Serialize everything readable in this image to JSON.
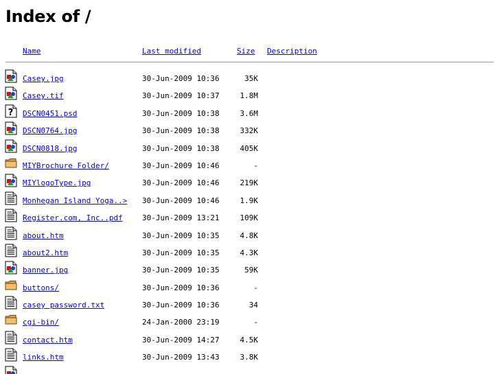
{
  "page": {
    "title": "Index of /"
  },
  "columns": {
    "name": "Name",
    "last_modified": "Last modified",
    "size": "Size",
    "description": "Description"
  },
  "entries": [
    {
      "icon": "image-icon",
      "name": "Casey.jpg",
      "modified": "30-Jun-2009 10:36",
      "size": "35K"
    },
    {
      "icon": "image-icon",
      "name": "Casey.tif",
      "modified": "30-Jun-2009 10:37",
      "size": "1.8M"
    },
    {
      "icon": "unknown-file-icon",
      "name": "DSCN0451.psd",
      "modified": "30-Jun-2009 10:38",
      "size": "3.6M"
    },
    {
      "icon": "image-icon",
      "name": "DSCN0764.jpg",
      "modified": "30-Jun-2009 10:38",
      "size": "332K"
    },
    {
      "icon": "image-icon",
      "name": "DSCN0818.jpg",
      "modified": "30-Jun-2009 10:38",
      "size": "405K"
    },
    {
      "icon": "folder-icon",
      "name": "MIYBrochure Folder/",
      "modified": "30-Jun-2009 10:46",
      "size": "-"
    },
    {
      "icon": "image-icon",
      "name": "MIYlogoType.jpg",
      "modified": "30-Jun-2009 10:46",
      "size": "219K"
    },
    {
      "icon": "text-file-icon",
      "name": "Monhegan Island Yoga..>",
      "modified": "30-Jun-2009 10:46",
      "size": "1.9K"
    },
    {
      "icon": "text-file-icon",
      "name": "Register.com, Inc..pdf",
      "modified": "30-Jun-2009 13:21",
      "size": "109K"
    },
    {
      "icon": "text-file-icon",
      "name": "about.htm",
      "modified": "30-Jun-2009 10:35",
      "size": "4.8K"
    },
    {
      "icon": "text-file-icon",
      "name": "about2.htm",
      "modified": "30-Jun-2009 10:35",
      "size": "4.3K"
    },
    {
      "icon": "image-icon",
      "name": "banner.jpg",
      "modified": "30-Jun-2009 10:35",
      "size": "59K"
    },
    {
      "icon": "folder-icon",
      "name": "buttons/",
      "modified": "30-Jun-2009 10:36",
      "size": "-"
    },
    {
      "icon": "text-file-icon",
      "name": "casey password.txt",
      "modified": "30-Jun-2009 10:36",
      "size": "34"
    },
    {
      "icon": "folder-icon",
      "name": "cgi-bin/",
      "modified": "24-Jan-2000 23:19",
      "size": "-"
    },
    {
      "icon": "text-file-icon",
      "name": "contact.htm",
      "modified": "30-Jun-2009 14:27",
      "size": "4.5K"
    },
    {
      "icon": "text-file-icon",
      "name": "links.htm",
      "modified": "30-Jun-2009 13:43",
      "size": "3.8K"
    },
    {
      "icon": "image-icon",
      "name": "",
      "modified": "",
      "size": ""
    }
  ]
}
